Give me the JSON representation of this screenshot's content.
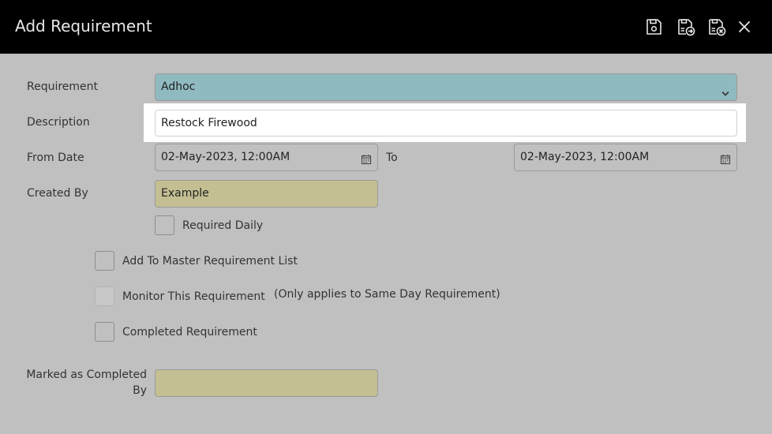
{
  "header": {
    "title": "Add Requirement",
    "icons": [
      "save-icon",
      "save-and-new-icon",
      "save-and-close-icon",
      "close-icon"
    ]
  },
  "form": {
    "requirement_label": "Requirement",
    "requirement_value": "Adhoc",
    "description_label": "Description",
    "description_value": "Restock Firewood",
    "from_date_label": "From Date",
    "from_date_value": "02-May-2023, 12:00AM",
    "to_label": "To",
    "to_date_value": "02-May-2023, 12:00AM",
    "created_by_label": "Created By",
    "created_by_value": "Example",
    "required_daily_label": "Required Daily",
    "add_master_label": "Add To Master Requirement List",
    "monitor_label": "Monitor This Requirement",
    "monitor_note": "(Only applies to Same Day Requirement)",
    "completed_label": "Completed Requirement",
    "marked_completed_label_line1": "Marked as Completed",
    "marked_completed_label_line2": "By",
    "marked_completed_value": ""
  },
  "colors": {
    "header_bg": "#000000",
    "page_bg": "#c0c0c0",
    "select_bg": "#8fbac0",
    "readonly_bg": "#c3bf92"
  }
}
